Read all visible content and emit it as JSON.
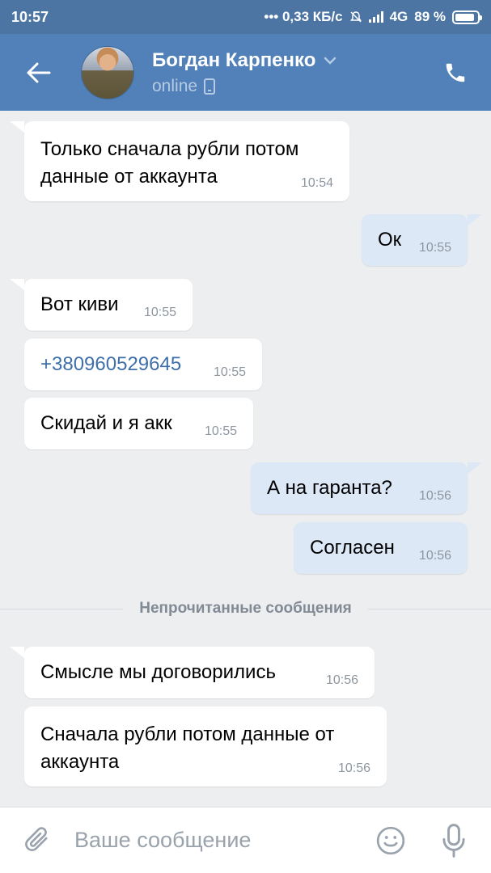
{
  "status_bar": {
    "time": "10:57",
    "network_speed": "••• 0,33 КБ/с",
    "network_type": "4G",
    "battery": "89 %",
    "battery_level": 0.89
  },
  "header": {
    "contact_name": "Богдан Карпенко",
    "contact_status": "online"
  },
  "messages": [
    {
      "direction": "in",
      "text_lines": [
        "Только сначала рубли потом",
        "данные от аккаунта"
      ],
      "time": "10:54"
    },
    {
      "direction": "out",
      "text": "Ок",
      "time": "10:55"
    },
    {
      "direction": "in",
      "text": "Вот киви",
      "time": "10:55"
    },
    {
      "direction": "in",
      "text": "+380960529645",
      "time": "10:55",
      "is_link": true
    },
    {
      "direction": "in",
      "text": "Скидай и я акк",
      "time": "10:55"
    },
    {
      "direction": "out",
      "text": "А на гаранта?",
      "time": "10:56"
    },
    {
      "direction": "out",
      "text": "Согласен",
      "time": "10:56"
    },
    {
      "direction": "in",
      "text": "Смысле мы договорились",
      "time": "10:56"
    },
    {
      "direction": "in",
      "text_lines": [
        "Сначала рубли потом данные от",
        "аккаунта"
      ],
      "time": "10:56"
    }
  ],
  "unread_divider": "Непрочитанные сообщения",
  "composer": {
    "placeholder": "Ваше сообщение"
  },
  "colors": {
    "header": "#5181b8",
    "status_bar": "#4c75a3",
    "incoming_bubble": "#ffffff",
    "outgoing_bubble": "#dce8f6",
    "link": "#3f6fa8",
    "background": "#edeef0"
  }
}
